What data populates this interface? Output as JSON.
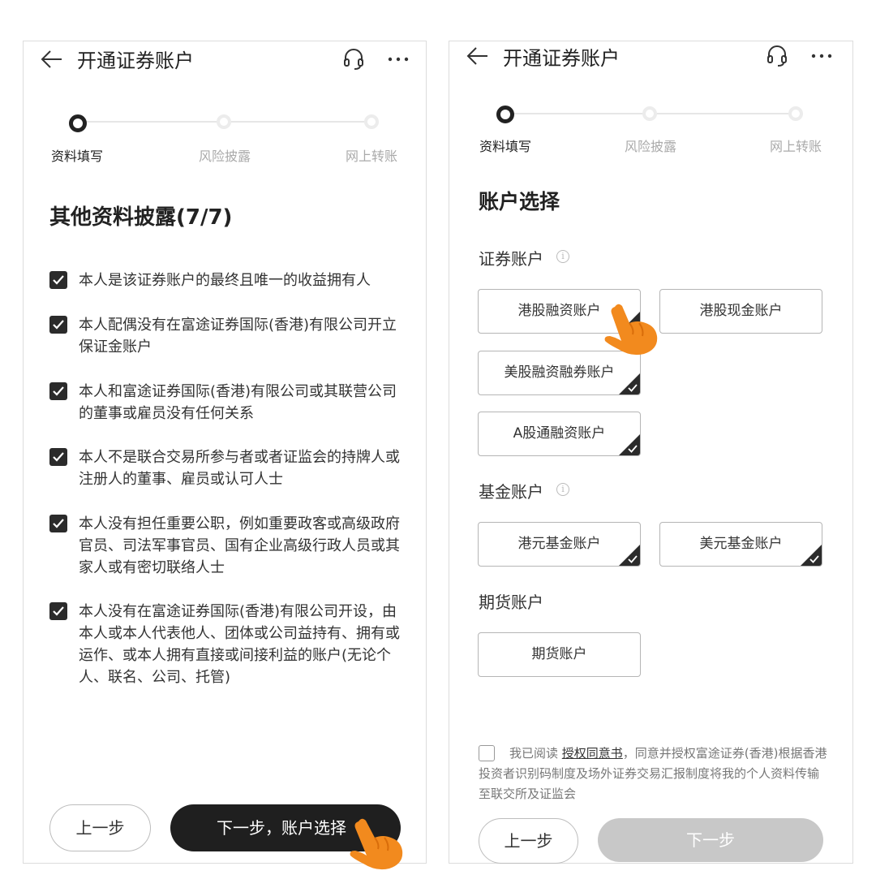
{
  "left": {
    "header": {
      "title": "开通证券账户"
    },
    "steps": [
      "资料填写",
      "风险披露",
      "网上转账"
    ],
    "heading": "其他资料披露(7/7)",
    "items": [
      "本人是该证券账户的最终且唯一的收益拥有人",
      "本人配偶没有在富途证券国际(香港)有限公司开立保证金账户",
      "本人和富途证券国际(香港)有限公司或其联营公司的董事或雇员没有任何关系",
      "本人不是联合交易所参与者或者证监会的持牌人或注册人的董事、雇员或认可人士",
      "本人没有担任重要公职，例如重要政客或高级政府官员、司法军事官员、国有企业高级行政人员或其家人或有密切联络人士",
      "本人没有在富途证券国际(香港)有限公司开设，由本人或本人代表他人、团体或公司益持有、拥有或运作、或本人拥有直接或间接利益的账户(无论个人、联名、公司、托管)"
    ],
    "prev_label": "上一步",
    "next_label": "下一步，账户选择"
  },
  "right": {
    "header": {
      "title": "开通证券账户"
    },
    "steps": [
      "资料填写",
      "风险披露",
      "网上转账"
    ],
    "heading": "账户选择",
    "securities_label": "证券账户",
    "fund_label": "基金账户",
    "futures_label": "期货账户",
    "info_glyph": "i",
    "securities": [
      {
        "label": "港股融资账户",
        "checked": true
      },
      {
        "label": "港股现金账户",
        "checked": false
      },
      {
        "label": "美股融资融券账户",
        "checked": true
      },
      {
        "label": "A股通融资账户",
        "checked": true
      }
    ],
    "funds": [
      {
        "label": "港元基金账户",
        "checked": true
      },
      {
        "label": "美元基金账户",
        "checked": true
      }
    ],
    "futures": [
      {
        "label": "期货账户",
        "checked": false
      }
    ],
    "agreement": {
      "prefix": "我已阅读 ",
      "link": "授权同意书",
      "suffix": "，同意并授权富途证券(香港)根据香港投资者识别码制度及场外证券交易汇报制度将我的个人资料传输至联交所及证监会"
    },
    "prev_label": "上一步",
    "next_label": "下一步"
  },
  "colors": {
    "dark": "#1f1f1f",
    "disabled": "#c8c8c8",
    "hand": "#f28a1e"
  }
}
